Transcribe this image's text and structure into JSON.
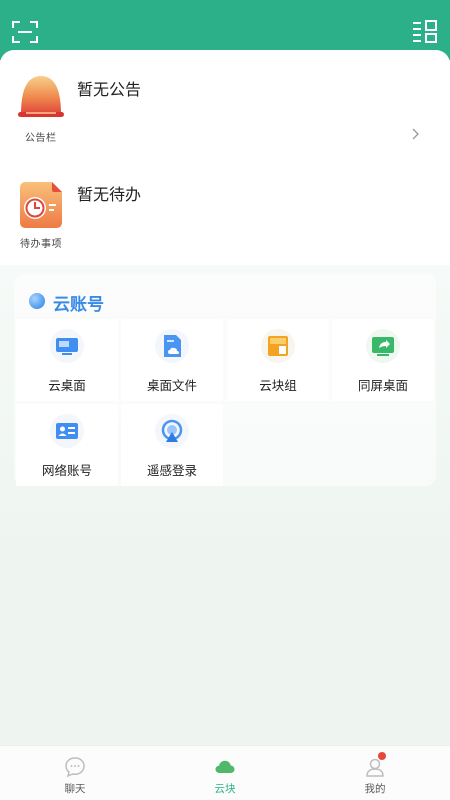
{
  "colors": {
    "brand": "#2bb08a",
    "accent_blue": "#3a8be8",
    "badge": "#e8453c"
  },
  "topbar": {
    "left_icon": "scan-icon",
    "right_icon": "grid-menu-icon"
  },
  "notice": {
    "title": "暂无公告",
    "caption": "公告栏",
    "icon": "bell-icon"
  },
  "todo": {
    "title": "暂无待办",
    "caption": "待办事项",
    "icon": "clock-document-icon"
  },
  "cloud_account": {
    "title": "云账号",
    "items": [
      {
        "label": "云桌面",
        "icon": "monitor-icon"
      },
      {
        "label": "桌面文件",
        "icon": "cloud-file-icon"
      },
      {
        "label": "云块组",
        "icon": "block-group-icon"
      },
      {
        "label": "同屏桌面",
        "icon": "screen-share-icon"
      },
      {
        "label": "网络账号",
        "icon": "id-card-icon"
      },
      {
        "label": "遥感登录",
        "icon": "remote-login-icon"
      }
    ]
  },
  "bottom_nav": [
    {
      "label": "聊天",
      "icon": "chat-icon",
      "active": false
    },
    {
      "label": "云块",
      "icon": "cloud-icon",
      "active": true
    },
    {
      "label": "我的",
      "icon": "profile-icon",
      "active": false,
      "badge": true
    }
  ]
}
